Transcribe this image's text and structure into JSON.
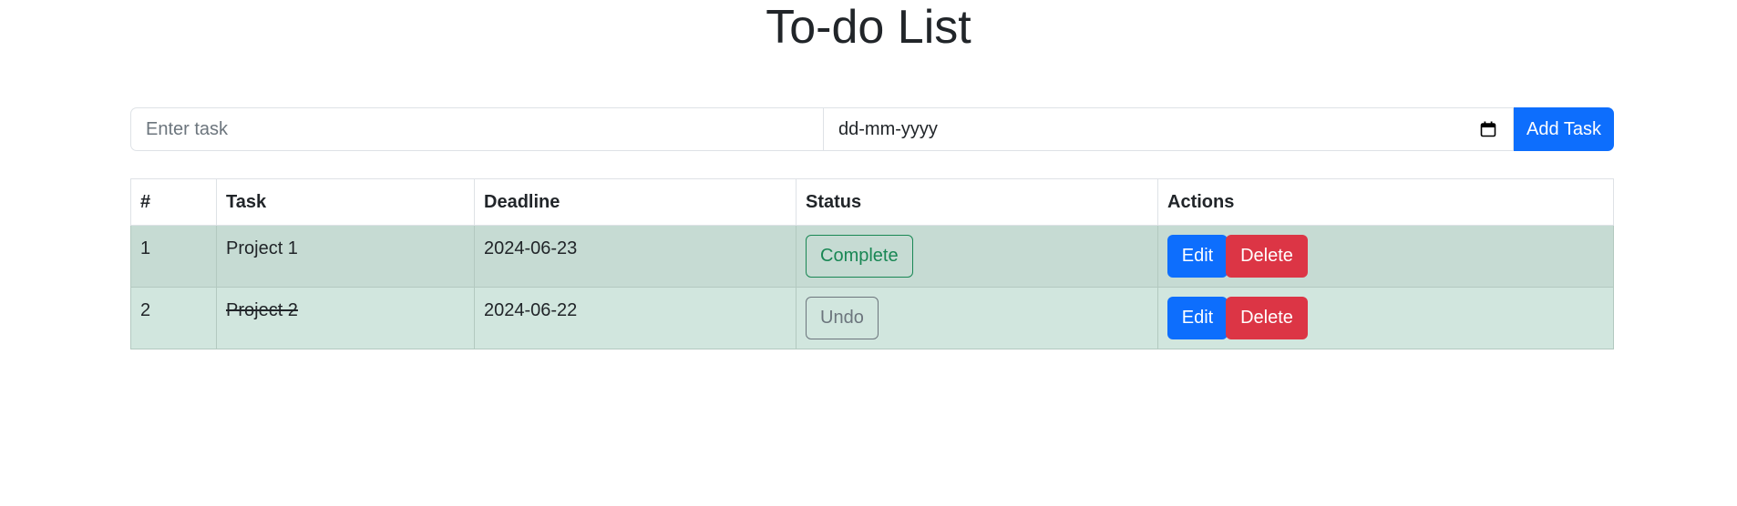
{
  "title": "To-do List",
  "form": {
    "task_placeholder": "Enter task",
    "date_value": "dd-mm-yyyy",
    "date_icon": "calendar-icon",
    "add_label": "Add Task"
  },
  "table": {
    "headers": [
      "#",
      "Task",
      "Deadline",
      "Status",
      "Actions"
    ],
    "rows": [
      {
        "num": "1",
        "task": "Project 1",
        "deadline": "2024-06-23",
        "status": "Complete",
        "completed": false,
        "edit": "Edit",
        "delete": "Delete"
      },
      {
        "num": "2",
        "task": "Project 2",
        "deadline": "2024-06-22",
        "status": "Undo",
        "completed": true,
        "edit": "Edit",
        "delete": "Delete"
      }
    ]
  },
  "colors": {
    "primary": "#0d6efd",
    "danger": "#dc3545",
    "success": "#198754",
    "secondary": "#6c757d",
    "row_pending": "#c6dbd3",
    "row_completed": "#d1e6de"
  }
}
